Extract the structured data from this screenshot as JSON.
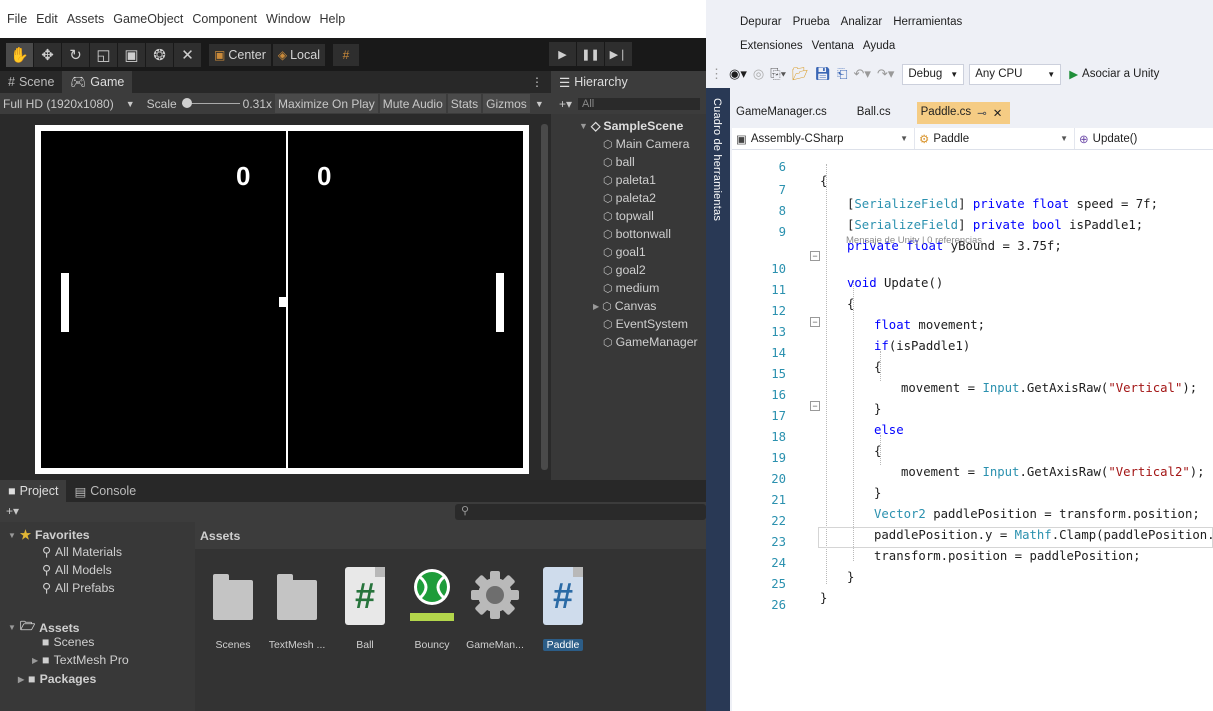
{
  "unity": {
    "menubar": [
      "File",
      "Edit",
      "Assets",
      "GameObject",
      "Component",
      "Window",
      "Help"
    ],
    "toolbar": {
      "tools": [
        "hand-icon",
        "move-icon",
        "rotate-icon",
        "scale-icon",
        "rect-tool-icon",
        "transform-icon",
        "custom-tool-icon"
      ],
      "pivot_label": "Center",
      "space_label": "Local",
      "play_buttons": [
        "play-icon",
        "pause-icon",
        "step-icon"
      ]
    },
    "scene_tab": "Scene",
    "game_tab": "Game",
    "game_bar": {
      "resolution": "Full HD (1920x1080)",
      "scale_label": "Scale",
      "scale_value": "0.31x",
      "maximize": "Maximize On Play",
      "mute": "Mute Audio",
      "stats": "Stats",
      "gizmos": "Gizmos"
    },
    "game": {
      "score_left": "0",
      "score_right": "0"
    },
    "hierarchy": {
      "tab": "Hierarchy",
      "search_placeholder": "All",
      "scene": "SampleScene",
      "items": [
        "Main Camera",
        "ball",
        "paleta1",
        "paleta2",
        "topwall",
        "bottonwall",
        "goal1",
        "goal2",
        "medium",
        "Canvas",
        "EventSystem",
        "GameManager"
      ]
    },
    "project": {
      "tab_project": "Project",
      "tab_console": "Console",
      "favorites": "Favorites",
      "favorite_items": [
        "All Materials",
        "All Models",
        "All Prefabs"
      ],
      "assets_root": "Assets",
      "asset_folders": [
        "Scenes",
        "TextMesh Pro"
      ],
      "packages": "Packages",
      "assets_header": "Assets",
      "assets": [
        "Scenes",
        "TextMesh ...",
        "Ball",
        "Bouncy",
        "GameMan...",
        "Paddle"
      ]
    }
  },
  "vs": {
    "menu_row1": [
      "Depurar",
      "Prueba",
      "Analizar",
      "Herramientas"
    ],
    "menu_row2": [
      "Extensiones",
      "Ventana",
      "Ayuda"
    ],
    "config": "Debug",
    "platform": "Any CPU",
    "attach": "Asociar a Unity",
    "side_panel": "Cuadro de herramientas",
    "file_tabs": [
      "GameManager.cs",
      "Ball.cs",
      "Paddle.cs"
    ],
    "nav": {
      "project": "Assembly-CSharp",
      "class": "Paddle",
      "member": "Update()"
    },
    "codelens": "Mensaje de Unity | 0 referencias",
    "line_numbers": [
      "6",
      "7",
      "8",
      "9",
      "10",
      "11",
      "12",
      "13",
      "14",
      "15",
      "16",
      "17",
      "18",
      "19",
      "20",
      "21",
      "22",
      "23",
      "24",
      "25",
      "26"
    ],
    "code": {
      "l6": "{",
      "l7": [
        "[",
        "SerializeField",
        "] ",
        "private",
        " ",
        "float",
        " speed = 7f;"
      ],
      "l8": [
        "[",
        "SerializeField",
        "] ",
        "private",
        " ",
        "bool",
        " isPaddle1;"
      ],
      "l9": [
        "private",
        " ",
        "float",
        " yBound = 3.75f;"
      ],
      "l10": [
        "void",
        " Update()"
      ],
      "l11": "{",
      "l12": [
        "float",
        " movement;"
      ],
      "l13": [
        "if",
        "(isPaddle1)"
      ],
      "l14": "{",
      "l15": [
        "movement = ",
        "Input",
        ".GetAxisRaw(",
        "\"Vertical\"",
        ");"
      ],
      "l16": "}",
      "l17": "else",
      "l18": "{",
      "l19": [
        "movement = ",
        "Input",
        ".GetAxisRaw(",
        "\"Vertical2\"",
        ");"
      ],
      "l20": "}",
      "l21": [
        "Vector2",
        " paddlePosition = transform.position;"
      ],
      "l22": [
        "paddlePosition.y = ",
        "Mathf",
        ".Clamp(paddlePosition.y"
      ],
      "l23": "transform.position = paddlePosition;",
      "l24": "}",
      "l25": "}"
    }
  }
}
